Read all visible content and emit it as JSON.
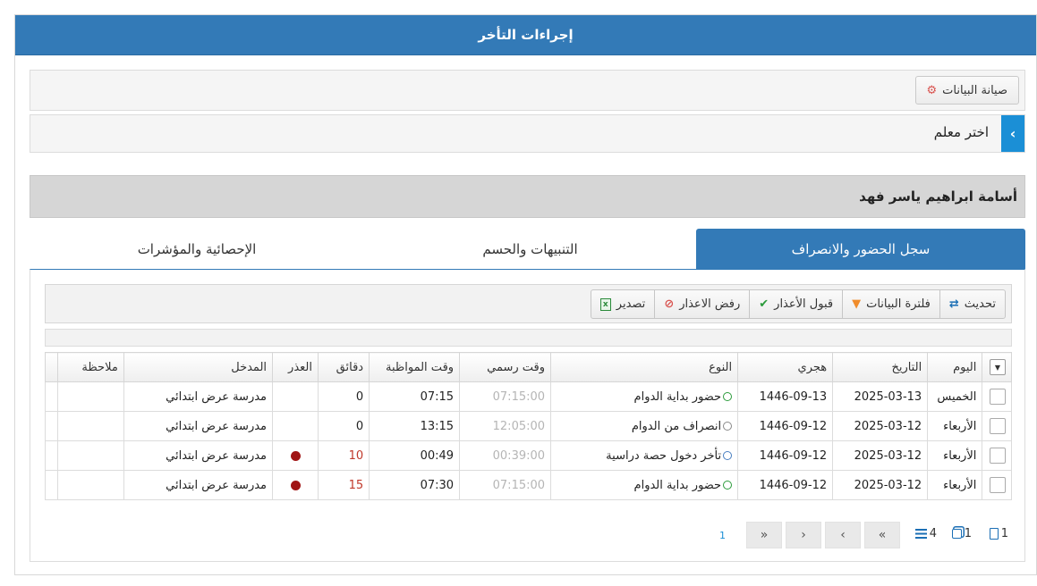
{
  "header": {
    "title": "إجراءات التأخر"
  },
  "toolbar_top": {
    "maintenance_label": "صيانة البيانات",
    "maintenance_icon": "gear-icon"
  },
  "teacher": {
    "label": "اختر معلم",
    "selected_name": "أسامة ابراهيم ياسر فهد"
  },
  "tabs": [
    {
      "label": "سجل الحضور والانصراف",
      "active": true
    },
    {
      "label": "التنبيهات والحسم",
      "active": false
    },
    {
      "label": "الإحصائية والمؤشرات",
      "active": false
    }
  ],
  "actions": {
    "refresh": "تحديث",
    "filter": "فلترة البيانات",
    "accept": "قبول الأعذار",
    "reject": "رفض الاعذار",
    "export": "تصدير"
  },
  "grid": {
    "columns": [
      "اليوم",
      "التاريخ",
      "هجري",
      "النوع",
      "وقت رسمي",
      "وقت المواظبة",
      "دقائق",
      "العذر",
      "المدخل",
      "ملاحظة"
    ],
    "rows": [
      {
        "day": "الخميس",
        "date": "2025-03-13",
        "hijri": "1446-09-13",
        "type": "حضور بداية الدوام",
        "official": "07:15:00",
        "attendance": "07:15",
        "minutes": "0",
        "minutes_late": false,
        "excuse": false,
        "entry": "مدرسة عرض ابتدائي",
        "note": "",
        "status_color": "#2a9a3a"
      },
      {
        "day": "الأربعاء",
        "date": "2025-03-12",
        "hijri": "1446-09-12",
        "type": "انصراف من الدوام",
        "official": "12:05:00",
        "attendance": "13:15",
        "minutes": "0",
        "minutes_late": false,
        "excuse": false,
        "entry": "مدرسة عرض ابتدائي",
        "note": "",
        "status_color": "#888888"
      },
      {
        "day": "الأربعاء",
        "date": "2025-03-12",
        "hijri": "1446-09-12",
        "type": "تأخر دخول حصة دراسية",
        "official": "00:39:00",
        "attendance": "00:49",
        "minutes": "10",
        "minutes_late": true,
        "excuse": true,
        "entry": "مدرسة عرض ابتدائي",
        "note": "",
        "status_color": "#4a7fc1"
      },
      {
        "day": "الأربعاء",
        "date": "2025-03-12",
        "hijri": "1446-09-12",
        "type": "حضور بداية الدوام",
        "official": "07:15:00",
        "attendance": "07:30",
        "minutes": "15",
        "minutes_late": true,
        "excuse": true,
        "entry": "مدرسة عرض ابتدائي",
        "note": "",
        "status_color": "#2a9a3a"
      }
    ]
  },
  "pager": {
    "page_count": "1",
    "current_page": "1",
    "page_size": "4",
    "total": "1",
    "first": "«",
    "prev": "‹",
    "next": "›",
    "last": "»",
    "current_link": "1"
  }
}
